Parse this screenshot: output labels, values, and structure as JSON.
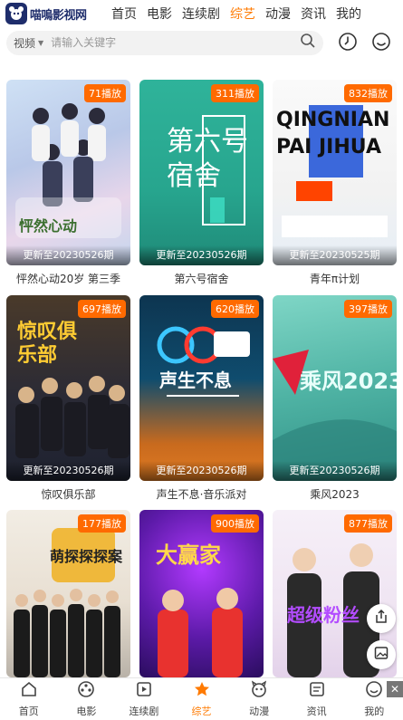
{
  "header": {
    "logo_text": "喵嗚影视网",
    "nav": [
      "首页",
      "电影",
      "连续剧",
      "综艺",
      "动漫",
      "资讯",
      "我的"
    ],
    "active_nav": 3
  },
  "search": {
    "category": "视频",
    "placeholder": "请输入关键字"
  },
  "cards": [
    {
      "title": "怦然心动20岁 第三季",
      "plays": "71播放",
      "update": "更新至20230526期",
      "overlay": "怦然心动"
    },
    {
      "title": "第六号宿舍",
      "plays": "311播放",
      "update": "更新至20230526期",
      "overlay": "第六号宿舍"
    },
    {
      "title": "青年π计划",
      "plays": "832播放",
      "update": "更新至20230525期",
      "overlay": "QINGNIAN PAI JIHUA"
    },
    {
      "title": "惊叹俱乐部",
      "plays": "697播放",
      "update": "更新至20230526期",
      "overlay": "惊叹俱乐部"
    },
    {
      "title": "声生不息·音乐派对",
      "plays": "620播放",
      "update": "更新至20230526期",
      "overlay": "声生不息"
    },
    {
      "title": "乘风2023",
      "plays": "397播放",
      "update": "更新至20230526期",
      "overlay": "乘风2023"
    },
    {
      "title": "",
      "plays": "177播放",
      "update": "",
      "overlay": "萌探探探案"
    },
    {
      "title": "",
      "plays": "900播放",
      "update": "",
      "overlay": "大赢家"
    },
    {
      "title": "",
      "plays": "877播放",
      "update": "",
      "overlay": "超级粉丝"
    }
  ],
  "tabbar": {
    "items": [
      "首页",
      "电影",
      "连续剧",
      "综艺",
      "动漫",
      "资讯",
      "我的"
    ],
    "active": 3
  },
  "colors": {
    "accent": "#ff7a00",
    "badge": "#ff6a00"
  }
}
